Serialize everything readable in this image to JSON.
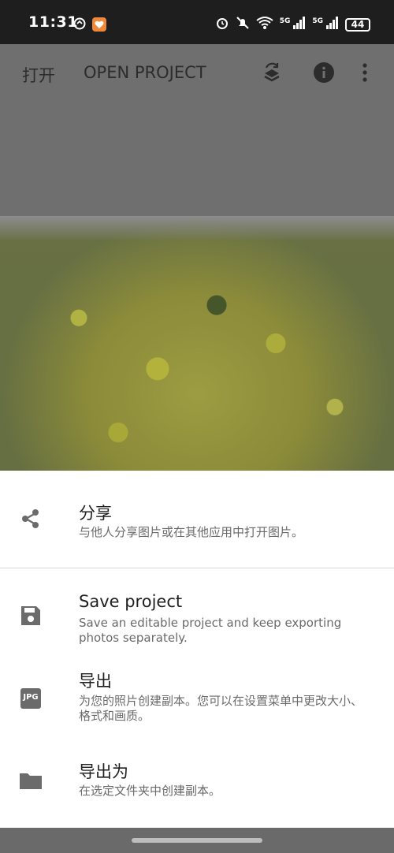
{
  "status_bar": {
    "time": "11:31",
    "battery": "44",
    "network_1": "5G",
    "network_2": "5G"
  },
  "app_bar": {
    "open_label": "打开",
    "open_project_label": "OPEN PROJECT",
    "icons": [
      "layers-swap-icon",
      "info-icon",
      "more-vert-icon"
    ]
  },
  "sheet": {
    "items": [
      {
        "icon": "share-icon",
        "title": "分享",
        "desc": "与他人分享图片或在其他应用中打开图片。"
      },
      {
        "icon": "save-icon",
        "title": "Save project",
        "desc": "Save an editable project and keep exporting photos separately."
      },
      {
        "icon": "jpg-icon",
        "icon_text": "JPG",
        "title": "导出",
        "desc": "为您的照片创建副本。您可以在设置菜单中更改大小、格式和画质。"
      },
      {
        "icon": "folder-icon",
        "title": "导出为",
        "desc": "在选定文件夹中创建副本。"
      }
    ]
  },
  "colors": {
    "scrim": "#6f6f6f",
    "status_bar": "#1e1e1e",
    "sheet_bg": "#ffffff",
    "icon_grey": "#6b6b6b"
  }
}
